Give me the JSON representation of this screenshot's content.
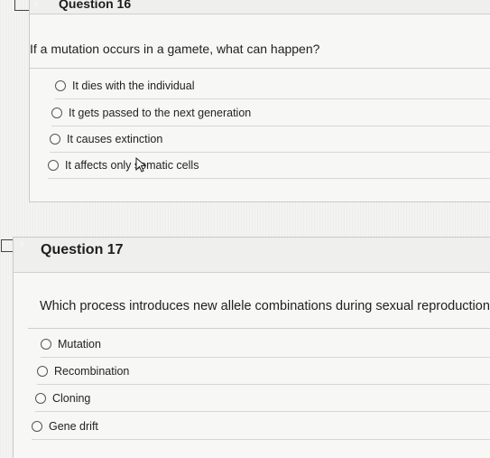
{
  "q16": {
    "title": "Question 16",
    "text": "If a mutation occurs in a gamete, what can happen?",
    "options": [
      "It dies with the individual",
      "It gets passed to the next generation",
      "It causes extinction",
      "It affects only somatic cells"
    ]
  },
  "q17": {
    "title": "Question 17",
    "text": "Which process introduces new allele combinations during sexual reproduction?",
    "options": [
      "Mutation",
      "Recombination",
      "Cloning",
      "Gene drift"
    ]
  }
}
